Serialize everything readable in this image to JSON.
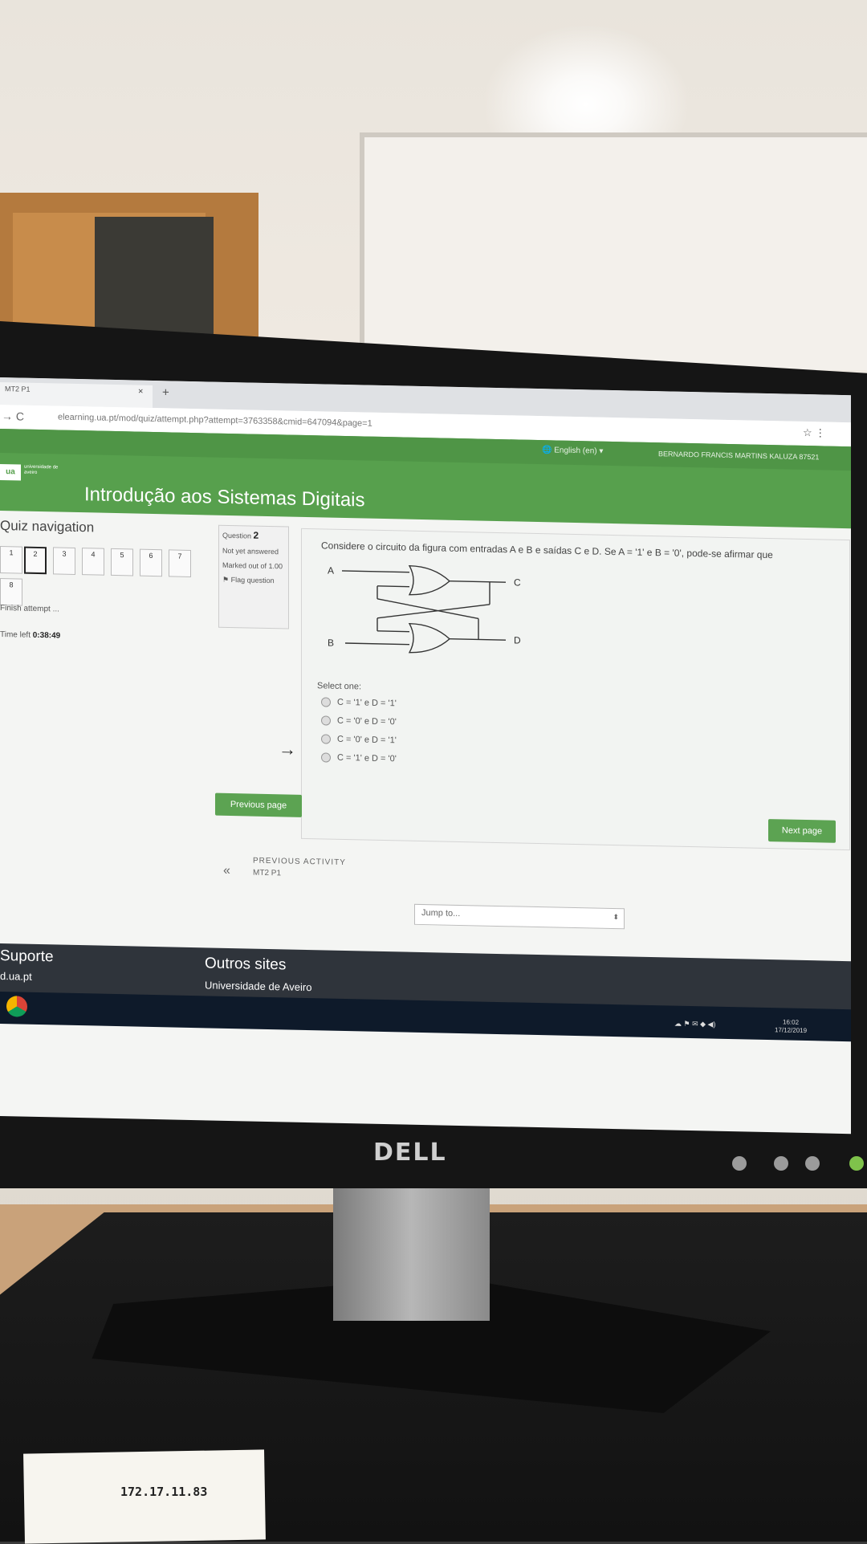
{
  "browser": {
    "tab_title": "MT2 P1",
    "tab_close": "×",
    "new_tab": "+",
    "nav_icons": "→  C",
    "url": "elearning.ua.pt/mod/quiz/attempt.php?attempt=3763358&cmid=647094&page=1",
    "addr_icons": "☆  ⋮"
  },
  "header": {
    "language": "🌐 English (en) ▾",
    "user": "BERNARDO FRANCIS MARTINS KALUZA 87521",
    "logo_text": "universidade de aveiro",
    "title": "Introdução aos Sistemas Digitais"
  },
  "quiz_nav": {
    "title": "Quiz navigation",
    "buttons": [
      "1",
      "2",
      "3",
      "4",
      "5",
      "6",
      "7",
      "8"
    ],
    "finish": "Finish attempt ...",
    "time_label": "Time left",
    "time_value": "0:38:49"
  },
  "question": {
    "number_label": "Question",
    "number": "2",
    "status": "Not yet answered",
    "marked": "Marked out of 1.00",
    "flag": "Flag question",
    "text": "Considere o circuito da figura com entradas A e B e saídas C e D. Se A = '1' e B = '0', pode-se afirmar que",
    "circuit_labels": {
      "a": "A",
      "b": "B",
      "c": "C",
      "d": "D"
    },
    "select_one": "Select one:",
    "options": [
      "C = '1' e D = '1'",
      "C = '0' e D = '0'",
      "C = '0' e D = '1'",
      "C = '1' e D = '0'"
    ]
  },
  "nav_buttons": {
    "previous_page": "Previous page",
    "next_page": "Next page"
  },
  "activity": {
    "label": "PREVIOUS ACTIVITY",
    "name": "MT2 P1",
    "arrow": "«"
  },
  "jump": {
    "placeholder": "Jump to...",
    "arrow": "⬍"
  },
  "footer": {
    "suporte": "Suporte",
    "suporte_link": "d.ua.pt",
    "outros": "Outros sites",
    "outros_link": "Universidade de Aveiro"
  },
  "taskbar": {
    "time": "16:02",
    "date": "17/12/2019"
  },
  "monitor": {
    "brand": "DELL"
  },
  "sticker": {
    "ip": "172.17.11.83"
  }
}
